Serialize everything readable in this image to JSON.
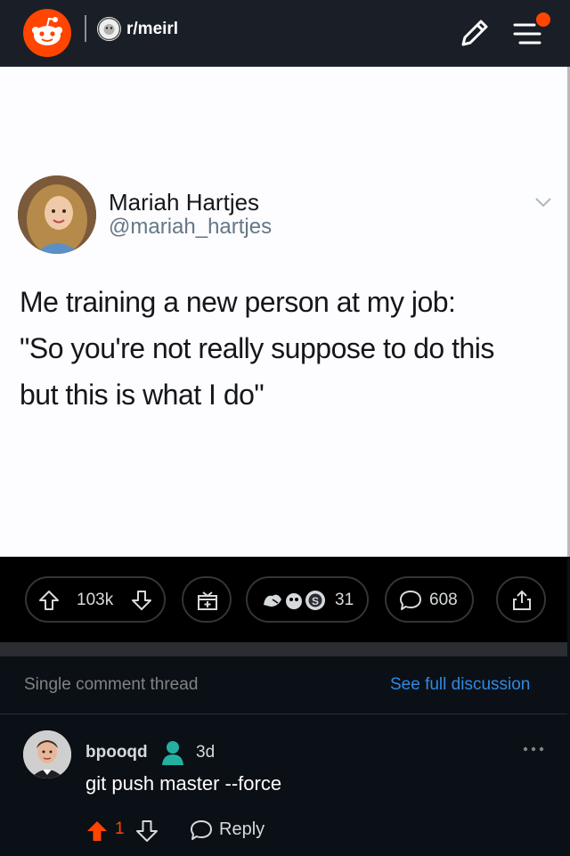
{
  "header": {
    "subreddit": "r/meirl",
    "accent": "#ff4500"
  },
  "post": {
    "tweet": {
      "name": "Mariah Hartjes",
      "handle": "@mariah_hartjes",
      "lines": [
        "Me training a new person at my job:",
        "\"So you're not really suppose to do this",
        "but this is what I do\""
      ]
    }
  },
  "actions": {
    "votes": "103k",
    "awards_count": "31",
    "comments": "608"
  },
  "thread": {
    "label": "Single comment thread",
    "link": "See full discussion"
  },
  "comment": {
    "author": "bpooqd",
    "time": "3d",
    "body": "git push master --force",
    "score": "1",
    "reply": "Reply"
  },
  "icons": [
    "reddit-logo",
    "pencil-icon",
    "menu-icon",
    "upvote-icon",
    "downvote-icon",
    "gift-icon",
    "comment-icon",
    "share-icon",
    "chevron-down-icon",
    "more-icon",
    "reply-icon",
    "user-status-icon"
  ]
}
